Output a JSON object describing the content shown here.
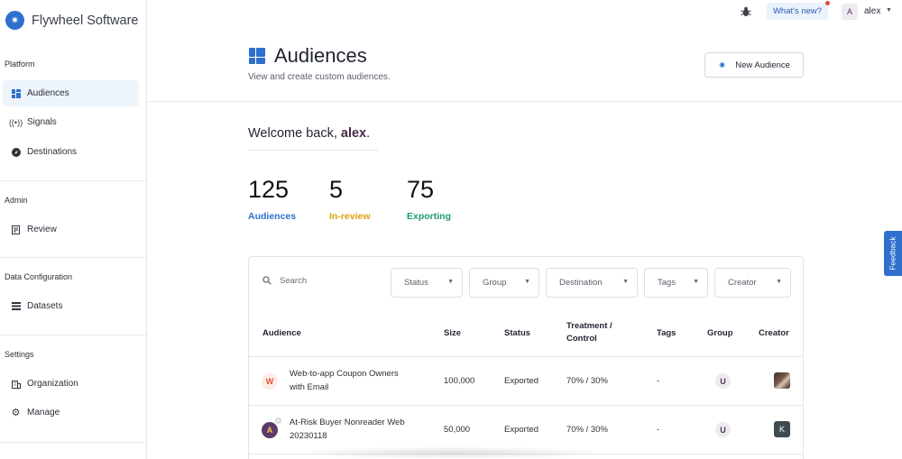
{
  "brand": {
    "name": "Flywheel Software",
    "logo_icon": "flywheel-logo-icon"
  },
  "sidebar": {
    "sections": [
      {
        "label": "Platform"
      },
      {
        "label": "Admin"
      },
      {
        "label": "Data Configuration"
      },
      {
        "label": "Settings"
      }
    ],
    "items": [
      {
        "label": "Audiences",
        "icon": "grid-icon",
        "active": true
      },
      {
        "label": "Signals",
        "icon": "signal-icon"
      },
      {
        "label": "Destinations",
        "icon": "compass-icon"
      },
      {
        "label": "Review",
        "icon": "document-icon"
      },
      {
        "label": "Datasets",
        "icon": "list-icon"
      },
      {
        "label": "Organization",
        "icon": "building-icon"
      },
      {
        "label": "Manage",
        "icon": "gear-icon"
      }
    ]
  },
  "topbar": {
    "whats_new": "What's new?",
    "user_initial": "A",
    "user_name": "alex"
  },
  "header": {
    "title": "Audiences",
    "subtitle": "View and create custom audiences.",
    "new_button": "New Audience"
  },
  "welcome": {
    "prefix": "Welcome back, ",
    "name": "alex",
    "suffix": "."
  },
  "stats": [
    {
      "value": "125",
      "label": "Audiences",
      "color": "#2f6fcd"
    },
    {
      "value": "5",
      "label": "In-review",
      "color": "#e0a210"
    },
    {
      "value": "75",
      "label": "Exporting",
      "color": "#1f9e6a"
    }
  ],
  "feedback_label": "Feedback",
  "table": {
    "search_placeholder": "Search",
    "filters": [
      "Status",
      "Group",
      "Destination",
      "Tags",
      "Creator"
    ],
    "columns": [
      "Audience",
      "Size",
      "Status",
      "Treatment / Control",
      "Tags",
      "Group",
      "Creator"
    ],
    "rows": [
      {
        "avatar": "W",
        "name": "Web-to-app Coupon Owners with Email",
        "size": "100,000",
        "status": "Exported",
        "treatment": "70% / 30%",
        "tags": "-",
        "group": "U",
        "creator": "photo"
      },
      {
        "avatar": "A",
        "name": "At-Risk Buyer Nonreader Web 20230118",
        "size": "50,000",
        "status": "Exported",
        "treatment": "70% / 30%",
        "tags": "-",
        "group": "U",
        "creator": "K"
      }
    ]
  }
}
